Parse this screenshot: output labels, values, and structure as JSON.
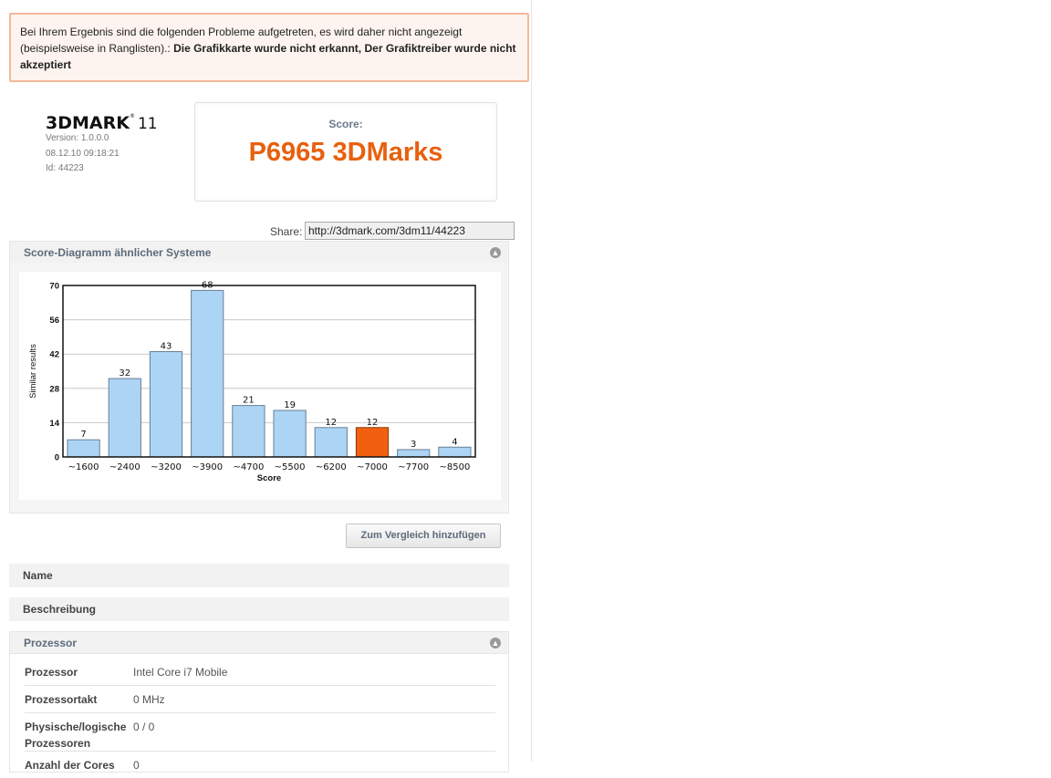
{
  "warning": {
    "text": "Bei Ihrem Ergebnis sind die folgenden Probleme aufgetreten, es wird daher nicht angezeigt (beispielsweise in Ranglisten).: ",
    "bold": "Die Grafikkarte wurde nicht erkannt, Der Grafiktreiber wurde nicht akzeptiert"
  },
  "logo": {
    "name": "3DMARK",
    "version_suffix": "11",
    "reg": "®"
  },
  "meta": {
    "version": "Version: 1.0.0.0",
    "date": "08.12.10 09:18:21",
    "id": "Id: 44223"
  },
  "score": {
    "label": "Score:",
    "value": "P6965 3DMarks"
  },
  "share": {
    "label": "Share:",
    "url": "http://3dmark.com/3dm11/44223"
  },
  "chart_panel": {
    "title": "Score-Diagramm ähnlicher Systeme",
    "collapse_icon": "collapse-up-icon"
  },
  "chart_data": {
    "type": "bar",
    "categories": [
      "~1600",
      "~2400",
      "~3200",
      "~3900",
      "~4700",
      "~5500",
      "~6200",
      "~7000",
      "~7700",
      "~8500"
    ],
    "values": [
      7,
      32,
      43,
      68,
      21,
      19,
      12,
      12,
      3,
      4
    ],
    "highlight_index": 7,
    "xlabel": "Score",
    "ylabel": "Similar results",
    "ylim": [
      0,
      70
    ],
    "yticks": [
      0,
      14,
      28,
      42,
      56,
      70
    ],
    "grid": true,
    "colors": {
      "bar": "#acd4f5",
      "highlight": "#f06010",
      "bar_border": "#6a7f93"
    }
  },
  "compare_button": {
    "label": "Zum Vergleich hinzufügen"
  },
  "rows": {
    "name": "Name",
    "description": "Beschreibung"
  },
  "processor_panel": {
    "title": "Prozessor"
  },
  "specs": [
    {
      "key": "Prozessor",
      "value": "Intel Core i7 Mobile"
    },
    {
      "key": "Prozessortakt",
      "value": "0 MHz"
    },
    {
      "key": "Physische/logische Prozessoren",
      "value": "0 / 0"
    },
    {
      "key": "Anzahl der Cores",
      "value": "0"
    }
  ],
  "colors": {
    "accent": "#e8600e",
    "panel_title": "#5d6b7b",
    "warning_border": "#f3b89a"
  }
}
